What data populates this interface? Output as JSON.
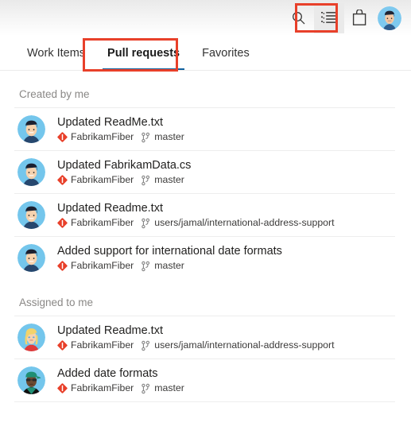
{
  "header": {
    "actions": [
      {
        "name": "search",
        "icon": "search-icon",
        "label": "Search",
        "selected": false
      },
      {
        "name": "work",
        "icon": "list-icon",
        "label": "Work",
        "selected": true
      },
      {
        "name": "marketplace",
        "icon": "shopping-bag-icon",
        "label": "Marketplace",
        "selected": false
      },
      {
        "name": "profile",
        "icon": "user-avatar-icon",
        "label": "User profile",
        "selected": false
      }
    ]
  },
  "tabs": [
    {
      "label": "Work Items",
      "active": false
    },
    {
      "label": "Pull requests",
      "active": true
    },
    {
      "label": "Favorites",
      "active": false
    }
  ],
  "sections": [
    {
      "title": "Created by me",
      "items": [
        {
          "title": "Updated ReadMe.txt",
          "repo": "FabrikamFiber",
          "branch": "master",
          "avatar": "avatar-man-dark-hair"
        },
        {
          "title": "Updated FabrikamData.cs",
          "repo": "FabrikamFiber",
          "branch": "master",
          "avatar": "avatar-man-dark-hair"
        },
        {
          "title": "Updated Readme.txt",
          "repo": "FabrikamFiber",
          "branch": "users/jamal/international-address-support",
          "avatar": "avatar-man-dark-hair"
        },
        {
          "title": "Added support for international date formats",
          "repo": "FabrikamFiber",
          "branch": "master",
          "avatar": "avatar-man-dark-hair"
        }
      ]
    },
    {
      "title": "Assigned to me",
      "items": [
        {
          "title": "Updated Readme.txt",
          "repo": "FabrikamFiber",
          "branch": "users/jamal/international-address-support",
          "avatar": "avatar-woman-blonde"
        },
        {
          "title": "Added date formats",
          "repo": "FabrikamFiber",
          "branch": "master",
          "avatar": "avatar-person-green-cap"
        }
      ]
    }
  ],
  "colors": {
    "annotation": "#e8402a",
    "tab_underline": "#10609e",
    "repo_icon": "#e8402a",
    "section_title": "#8a8886"
  }
}
